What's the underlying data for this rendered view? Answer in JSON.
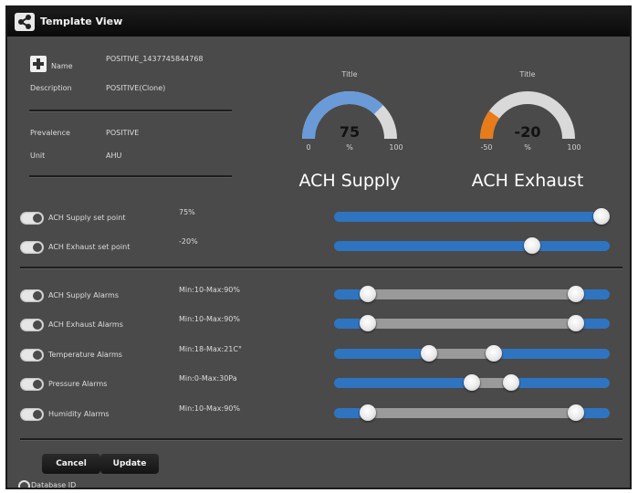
{
  "window": {
    "title": "Template View"
  },
  "info": {
    "name_label": "Name",
    "name_value": "POSITIVE_1437745844768",
    "description_label": "Description",
    "description_value": "POSITIVE(Clone)",
    "prevalence_label": "Prevalence",
    "prevalence_value": "POSITIVE",
    "unit_label": "Unit",
    "unit_value": "AHU"
  },
  "gauges": [
    {
      "title": "Title",
      "value_text": "75",
      "value": 75,
      "min": 0,
      "max": 100,
      "min_label": "0",
      "max_label": "100",
      "unit": "%",
      "caption": "ACH Supply",
      "color": "#6a9bd8"
    },
    {
      "title": "Title",
      "value_text": "-20",
      "value": -20,
      "min": -50,
      "max": 100,
      "min_label": "-50",
      "max_label": "100",
      "unit": "%",
      "caption": "ACH Exhaust",
      "color": "#e87b1a"
    }
  ],
  "setpoints": [
    {
      "label": "ACH Supply set point",
      "value_text": "75%",
      "value": 75,
      "min": 0,
      "max": 75
    },
    {
      "label": "ACH Exhaust set point",
      "value_text": "-20%",
      "value": -20,
      "min": -75,
      "max": 0
    }
  ],
  "alarms": [
    {
      "label": "ACH Supply Alarms",
      "range_text": "Min:10-Max:90%",
      "low": 10,
      "high": 90,
      "min": 0,
      "max": 100
    },
    {
      "label": "ACH Exhaust Alarms",
      "range_text": "Min:10-Max:90%",
      "low": 10,
      "high": 90,
      "min": 0,
      "max": 100
    },
    {
      "label": "Temperature Alarms",
      "range_text": "Min:18-Max:21C°",
      "low": 18,
      "high": 21,
      "min": 14,
      "max": 26
    },
    {
      "label": "Pressure Alarms",
      "range_text": "Min:0-Max:30Pa",
      "low": 0,
      "high": 30,
      "min": -100,
      "max": 100
    },
    {
      "label": "Humidity Alarms",
      "range_text": "Min:10-Max:90%",
      "low": 10,
      "high": 90,
      "min": 0,
      "max": 100
    }
  ],
  "buttons": {
    "cancel": "Cancel",
    "update": "Update"
  },
  "footer": {
    "database_id_label": "Database ID"
  },
  "colors": {
    "track": "#2f74c0",
    "range": "#9a9a9a",
    "panel": "#4a4a4a"
  }
}
